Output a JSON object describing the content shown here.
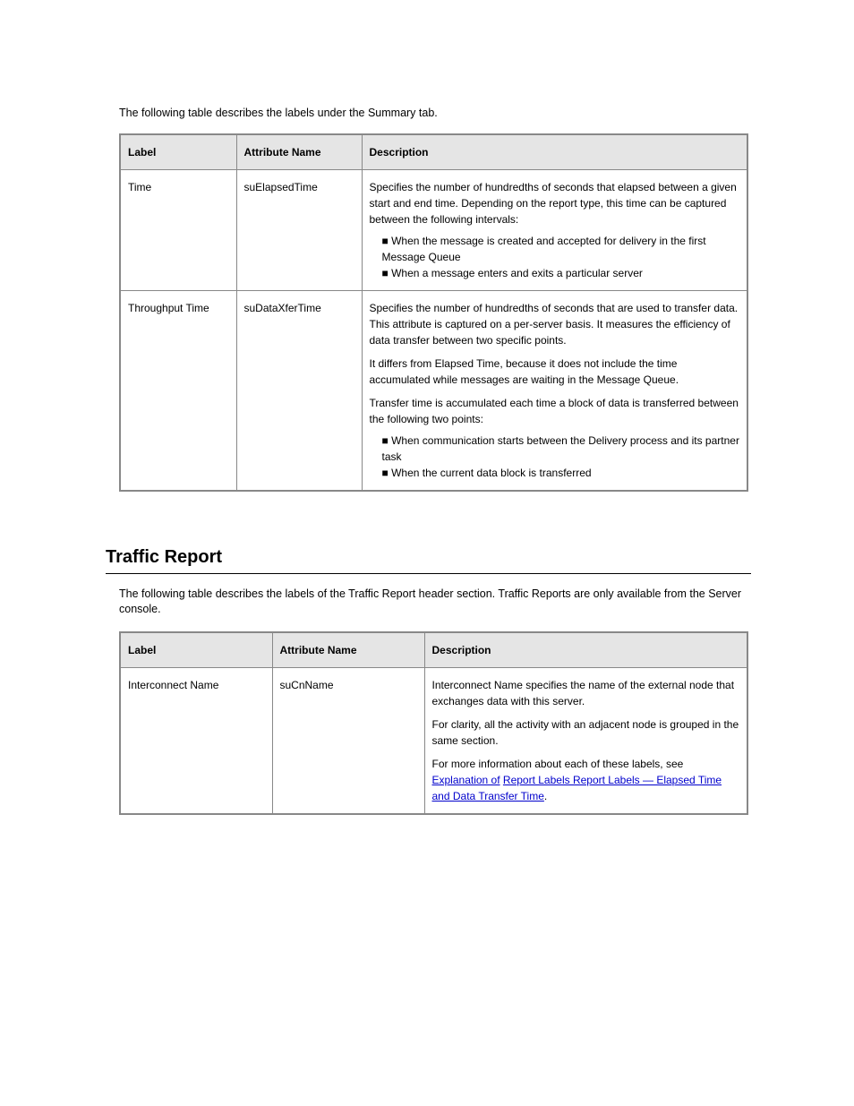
{
  "intro": "The following table describes the labels under the Summary tab.",
  "table1": {
    "headers": [
      "Label",
      "Attribute Name",
      "Description"
    ],
    "rows": [
      {
        "label": "Time",
        "attr": "suElapsedTime",
        "desc": "Specifies the number of hundredths of seconds that elapsed between a given start and end time. Depending on the report type, this time can be captured between the following intervals:",
        "bullets": [
          "When the message is created and accepted for delivery in the first Message Queue",
          "When a message enters and exits a particular server"
        ]
      },
      {
        "label": "Throughput Time",
        "attr": "suDataXferTime",
        "desc_parts": [
          "Specifies the number of hundredths of seconds that are used to transfer data. This attribute is captured on a per-server basis. It measures the efficiency of data transfer between two specific points.",
          "It differs from Elapsed Time, because it does not include the time accumulated while messages are waiting in the Message Queue.",
          "Transfer time is accumulated each time a block of data is transferred between the following two points:",
          "Bullet: When communication starts between the Delivery process and its partner task",
          "Bullet: When the current data block is transferred"
        ],
        "bullets": [
          "When communication starts between the Delivery process and its partner task",
          "When the current data block is transferred"
        ]
      }
    ]
  },
  "section": {
    "title": "Traffic Report",
    "sub": "The following table describes the labels of the Traffic Report header section. Traffic Reports are only available from the Server console."
  },
  "table2": {
    "headers": [
      "Label",
      "Attribute Name",
      "Description"
    ],
    "rows": [
      {
        "label": "Interconnect Name",
        "attr": "suCnName",
        "desc_lines": [
          "Interconnect Name specifies the name of the external node that exchanges data with this server.",
          "For clarity, all the activity with an adjacent node is grouped in the same section.",
          "For more information about each of these labels, see "
        ],
        "link1": "Explanation of",
        "link2": "Report Labels Report Labels — Elapsed Time and Data Transfer Time",
        "period": "."
      }
    ]
  }
}
